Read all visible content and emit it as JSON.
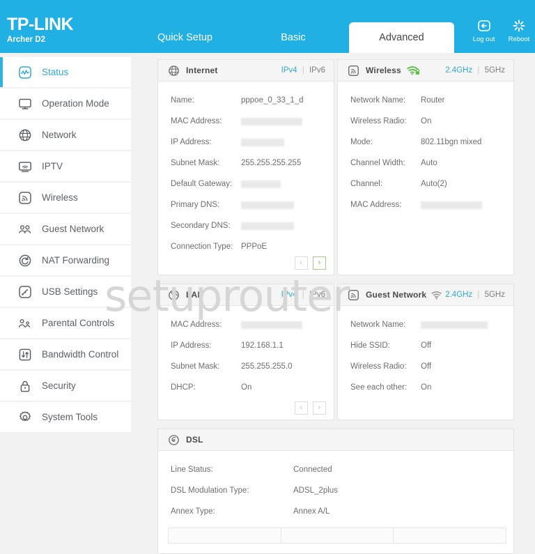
{
  "header": {
    "brand": "TP-LINK",
    "model": "Archer D2",
    "tabs": [
      {
        "label": "Quick Setup",
        "active": false
      },
      {
        "label": "Basic",
        "active": false
      },
      {
        "label": "Advanced",
        "active": true
      }
    ],
    "actions": [
      {
        "label": "Log out",
        "icon": "logout-icon"
      },
      {
        "label": "Reboot",
        "icon": "reboot-icon"
      }
    ],
    "bg_color": "#20b0e3"
  },
  "sidebar": {
    "items": [
      {
        "label": "Status",
        "icon": "status-icon",
        "active": true
      },
      {
        "label": "Operation Mode",
        "icon": "monitor-icon",
        "active": false
      },
      {
        "label": "Network",
        "icon": "globe-icon",
        "active": false
      },
      {
        "label": "IPTV",
        "icon": "iptv-icon",
        "active": false
      },
      {
        "label": "Wireless",
        "icon": "wireless-icon",
        "active": false
      },
      {
        "label": "Guest Network",
        "icon": "guest-network-icon",
        "active": false
      },
      {
        "label": "NAT Forwarding",
        "icon": "nat-forwarding-icon",
        "active": false
      },
      {
        "label": "USB Settings",
        "icon": "usb-settings-icon",
        "active": false
      },
      {
        "label": "Parental Controls",
        "icon": "parental-controls-icon",
        "active": false
      },
      {
        "label": "Bandwidth Control",
        "icon": "bandwidth-control-icon",
        "active": false
      },
      {
        "label": "Security",
        "icon": "lock-icon",
        "active": false
      },
      {
        "label": "System Tools",
        "icon": "gear-icon",
        "active": false
      }
    ],
    "active_accent": "#2fa8cf"
  },
  "watermark": "setuprouter",
  "panels": {
    "internet": {
      "title": "Internet",
      "icon": "globe-icon",
      "toggle_on": "IPv4",
      "toggle_sep": "|",
      "toggle_off": "IPv6",
      "rows": [
        {
          "key": "Name:",
          "value": "pppoe_0_33_1_d",
          "redacted": false
        },
        {
          "key": "MAC Address:",
          "value": "",
          "redacted": true,
          "redact_width": 88
        },
        {
          "key": "IP Address:",
          "value": "",
          "redacted": true,
          "redact_width": 62
        },
        {
          "key": "Subnet Mask:",
          "value": "255.255.255.255",
          "redacted": false
        },
        {
          "key": "Default Gateway:",
          "value": "",
          "redacted": true,
          "redact_width": 57
        },
        {
          "key": "Primary DNS:",
          "value": "",
          "redacted": true,
          "redact_width": 76
        },
        {
          "key": "Secondary DNS:",
          "value": "",
          "redacted": true,
          "redact_width": 76
        },
        {
          "key": "Connection Type:",
          "value": "PPPoE",
          "redacted": false
        }
      ],
      "pager": {
        "prev": "‹",
        "next": "›",
        "next_active": true
      }
    },
    "wireless": {
      "title": "Wireless",
      "icon": "wireless-icon",
      "wifi_icon": "wifi-secured-icon",
      "wifi_color": "#5bbf4a",
      "toggle_on": "2.4GHz",
      "toggle_sep": "|",
      "toggle_off": "5GHz",
      "rows": [
        {
          "key": "Network Name:",
          "value": "Router",
          "redacted": false
        },
        {
          "key": "Wireless Radio:",
          "value": "On",
          "redacted": false
        },
        {
          "key": "Mode:",
          "value": "802.11bgn mixed",
          "redacted": false
        },
        {
          "key": "Channel Width:",
          "value": "Auto",
          "redacted": false
        },
        {
          "key": "Channel:",
          "value": "Auto(2)",
          "redacted": false
        },
        {
          "key": "MAC Address:",
          "value": "",
          "redacted": true,
          "redact_width": 88
        }
      ]
    },
    "lan": {
      "title": "LAN",
      "icon": "lan-globe-icon",
      "toggle_on": "IPv4",
      "toggle_sep": "|",
      "toggle_off": "IPv6",
      "rows": [
        {
          "key": "MAC Address:",
          "value": "",
          "redacted": true,
          "redact_width": 88
        },
        {
          "key": "IP Address:",
          "value": "192.168.1.1",
          "redacted": false
        },
        {
          "key": "Subnet Mask:",
          "value": "255.255.255.0",
          "redacted": false
        },
        {
          "key": "DHCP:",
          "value": "On",
          "redacted": false
        }
      ],
      "pager": {
        "prev": "‹",
        "next": "›",
        "next_active": false
      }
    },
    "guest_network": {
      "title": "Guest Network",
      "icon": "wireless-icon",
      "wifi_icon": "wifi-icon",
      "wifi_color": "#9a9a9a",
      "toggle_on": "2.4GHz",
      "toggle_sep": "|",
      "toggle_off": "5GHz",
      "rows": [
        {
          "key": "Network Name:",
          "value": "",
          "redacted": true,
          "redact_width": 96
        },
        {
          "key": "Hide SSID:",
          "value": "Off",
          "redacted": false
        },
        {
          "key": "Wireless Radio:",
          "value": "Off",
          "redacted": false
        },
        {
          "key": "See each other:",
          "value": "On",
          "redacted": false
        }
      ]
    },
    "dsl": {
      "title": "DSL",
      "icon": "dsl-icon",
      "rows": [
        {
          "key": "Line Status:",
          "value": "Connected",
          "redacted": false
        },
        {
          "key": "DSL Modulation Type:",
          "value": "ADSL_2plus",
          "redacted": false
        },
        {
          "key": "Annex Type:",
          "value": "Annex A/L",
          "redacted": false
        }
      ],
      "table_columns": [
        "",
        "",
        ""
      ]
    }
  }
}
